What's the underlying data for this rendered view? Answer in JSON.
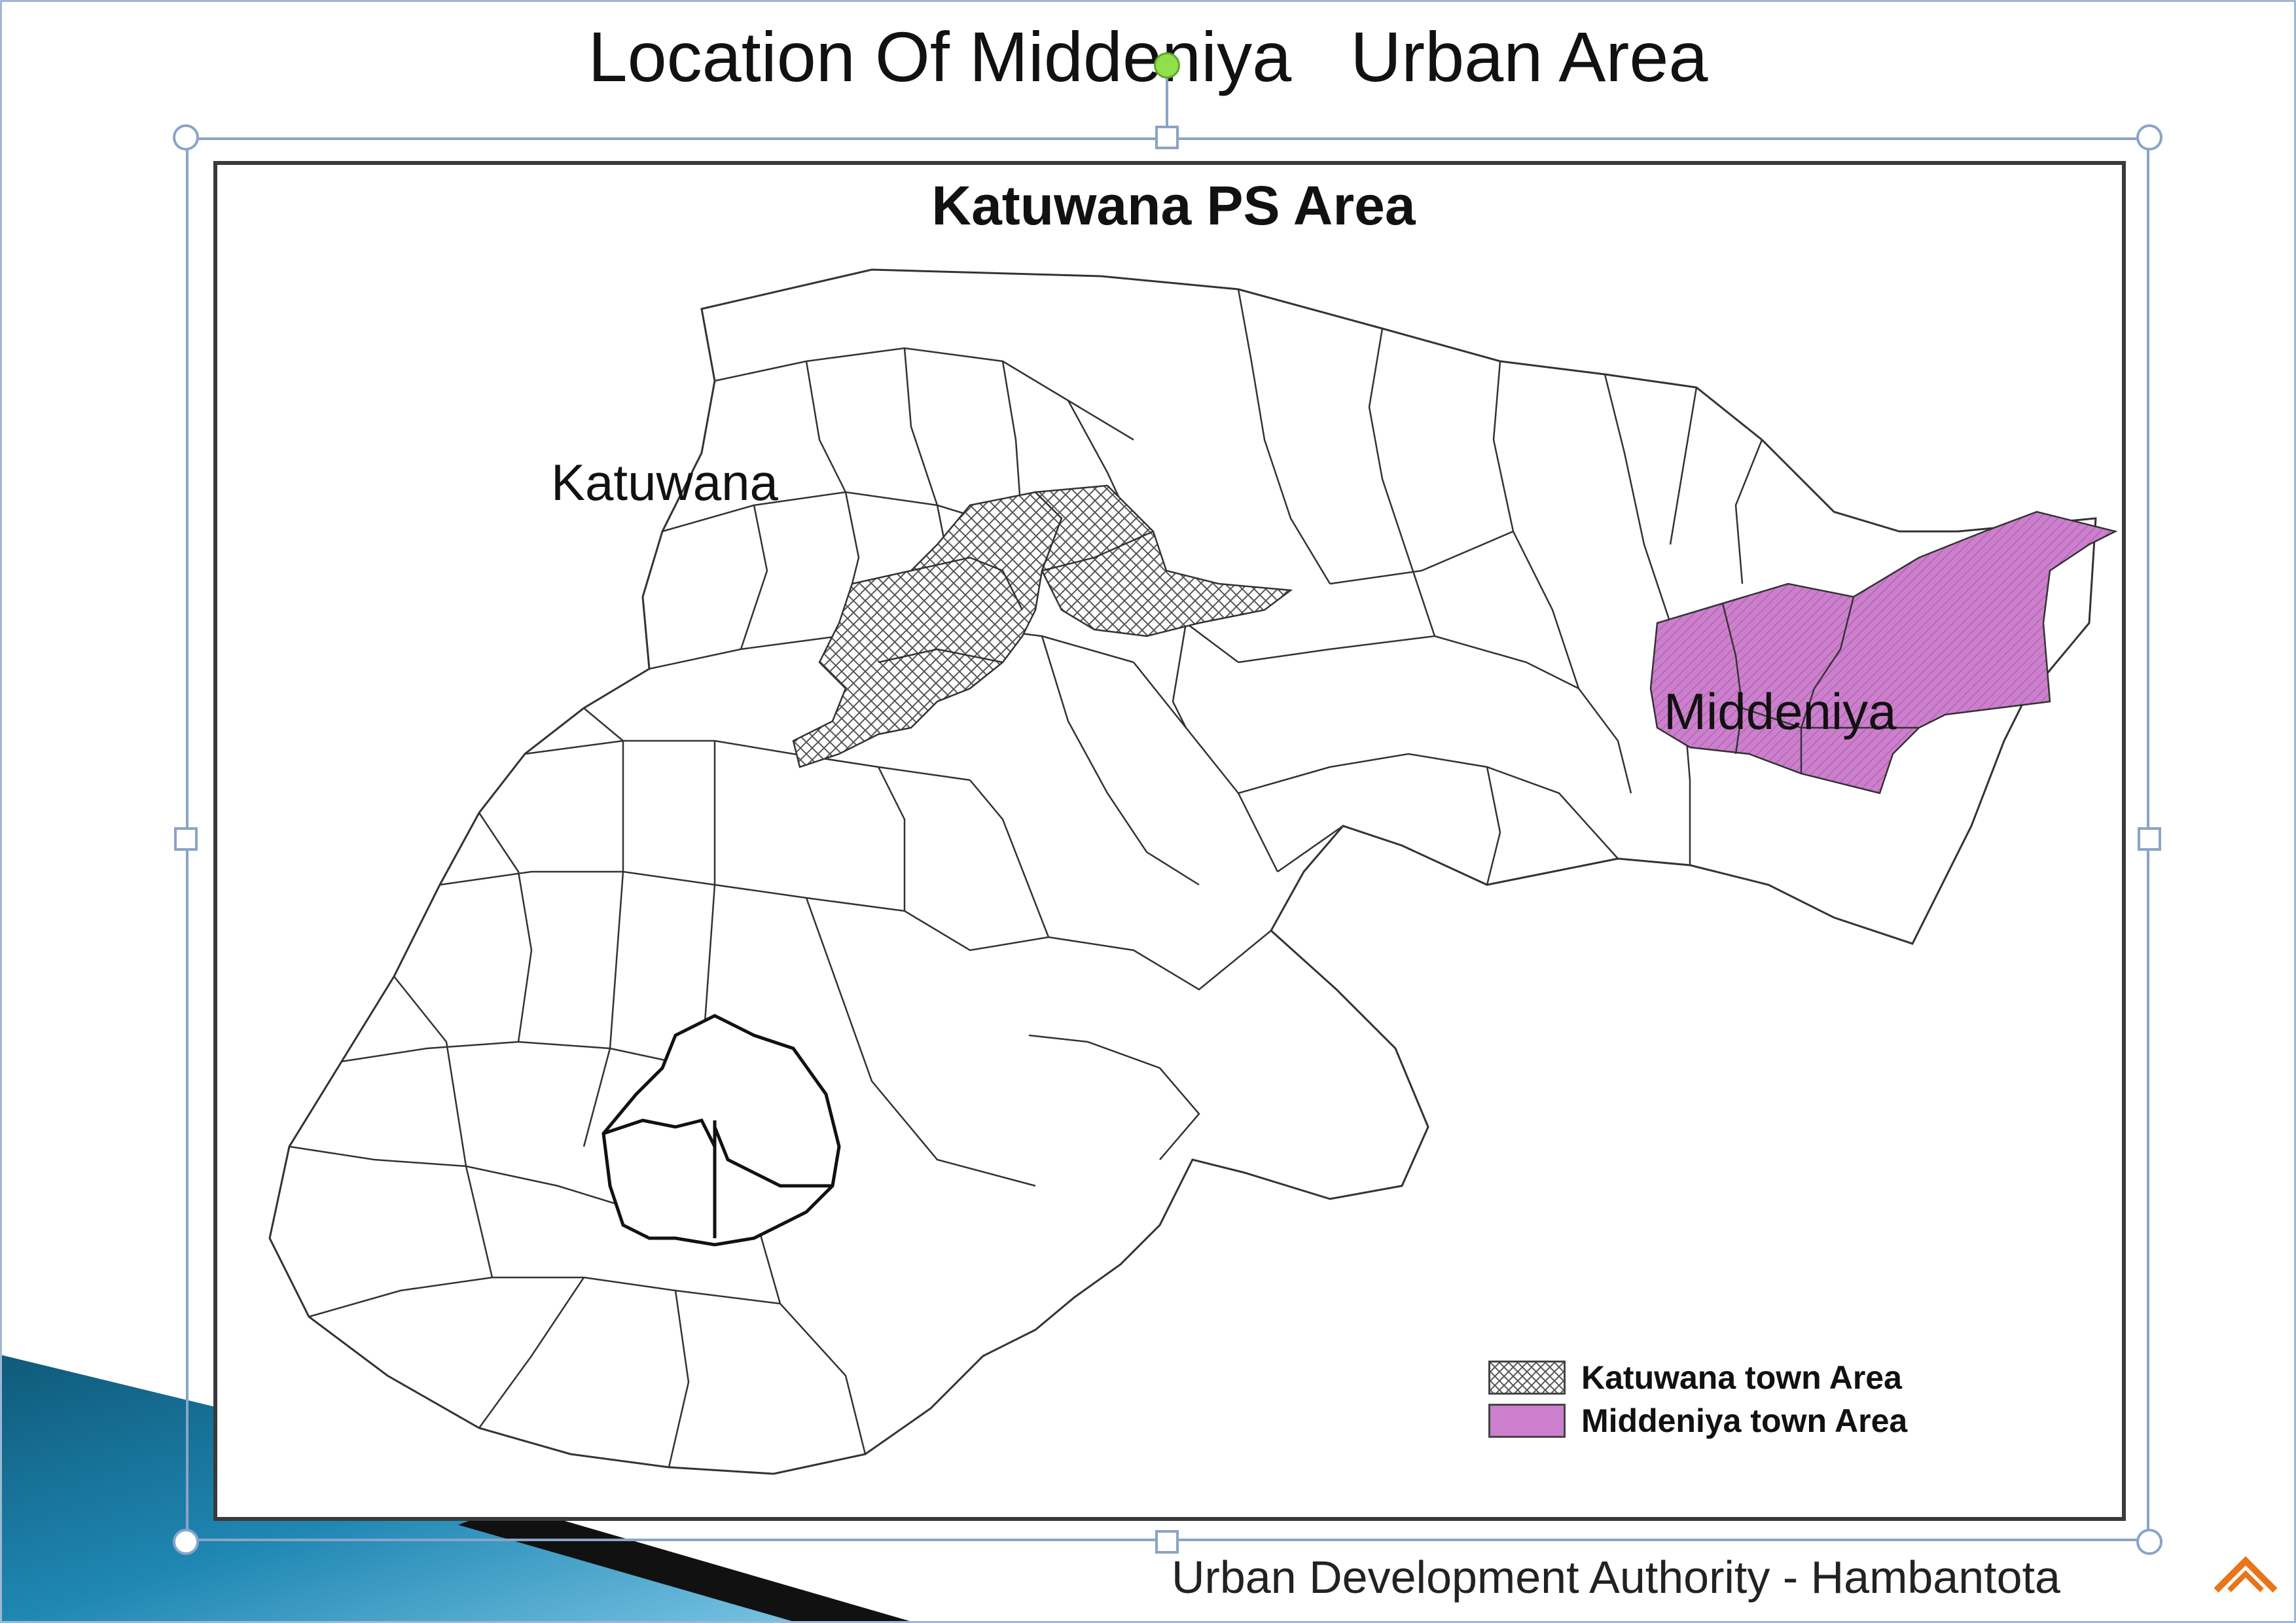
{
  "slide": {
    "title": "Location Of Middeniya   Urban Area",
    "footer_text": "Urban Development Authority - Hambantota",
    "logo_icon": "uda-chevron-logo-icon",
    "accent_color": "#1f7fa8"
  },
  "map": {
    "title": "Katuwana PS Area",
    "labels": {
      "katuwana": "Katuwana",
      "middeniya": "Middeniya"
    },
    "colors": {
      "middeniya_fill": "#cc7fcc",
      "katuwana_hatch": "#555555",
      "boundary": "#333333"
    }
  },
  "legend": {
    "items": [
      {
        "label": "Katuwana town Area",
        "pattern": "crosshatch"
      },
      {
        "label": "Middeniya town Area",
        "pattern": "magenta-hatch"
      }
    ]
  }
}
